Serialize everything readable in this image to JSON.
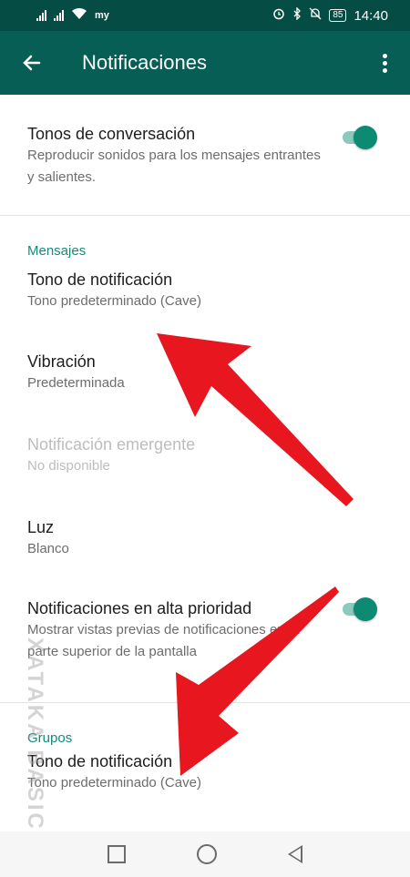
{
  "status_bar": {
    "time": "14:40",
    "battery": "85",
    "carrier": "my",
    "icons": [
      "signal-icon",
      "signal-icon",
      "wifi-icon",
      "alarm-icon",
      "bluetooth-icon",
      "mute-icon",
      "battery-icon"
    ]
  },
  "app_bar": {
    "title": "Notificaciones",
    "back_icon": "arrow-left-icon",
    "menu_icon": "more-vert-icon"
  },
  "settings": {
    "conversation_tones": {
      "title": "Tonos de conversación",
      "subtitle": "Reproducir sonidos para los mensajes entrantes y salientes.",
      "enabled": true
    },
    "messages": {
      "header": "Mensajes",
      "notification_tone": {
        "title": "Tono de notificación",
        "subtitle": "Tono predeterminado (Cave)"
      },
      "vibration": {
        "title": "Vibración",
        "subtitle": "Predeterminada"
      },
      "popup": {
        "title": "Notificación emergente",
        "subtitle": "No disponible",
        "disabled": true
      },
      "light": {
        "title": "Luz",
        "subtitle": "Blanco"
      },
      "high_priority": {
        "title": "Notificaciones en alta prioridad",
        "subtitle": "Mostrar vistas previas de notificaciones en la parte superior de la pantalla",
        "enabled": true
      }
    },
    "groups": {
      "header": "Grupos",
      "notification_tone": {
        "title": "Tono de notificación",
        "subtitle": "Tono predeterminado (Cave)"
      }
    }
  },
  "watermark": "XATAKA BASICS",
  "annotation_color": "#e8171f",
  "theme": {
    "primary": "#075e54",
    "accent": "#128c7e"
  }
}
